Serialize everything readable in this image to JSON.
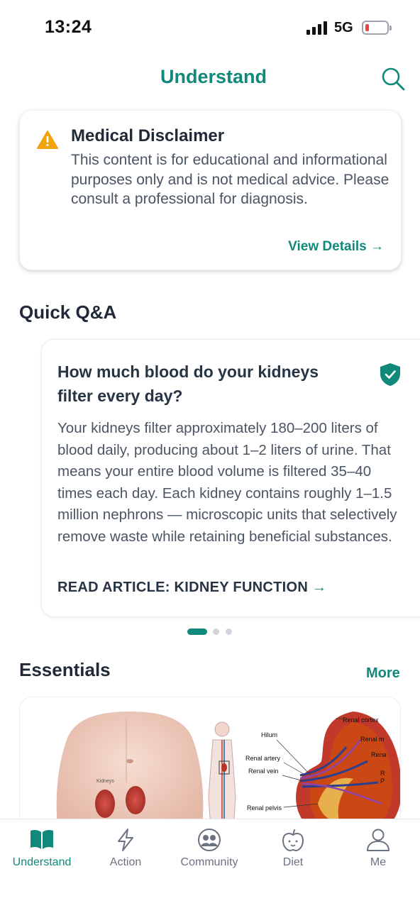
{
  "status_bar": {
    "time": "13:24",
    "network": "5G"
  },
  "header": {
    "title": "Understand"
  },
  "disclaimer": {
    "title": "Medical Disclaimer",
    "text": "This content is for educational and informational purposes only and is not medical advice. Please consult a professional for diagnosis.",
    "link_label": "View Details →"
  },
  "quick_qa": {
    "title": "Quick Q&A",
    "question": "How much blood do your kidneys filter every day?",
    "answer": "Your kidneys filter approximately 180–200 liters of blood daily, producing about 1–2 liters of urine. That means your entire blood volume is filtered 35–40 times each day. Each kidney contains roughly 1–1.5 million nephrons — microscopic units that selectively remove waste while retaining beneficial substances.",
    "read_label": "READ ARTICLE: KIDNEY FUNCTION",
    "read_arrow": "→",
    "page_count": 3,
    "active_page": 1
  },
  "essentials": {
    "title": "Essentials",
    "more_label": "More",
    "diagram_labels": {
      "small": "Kidneys",
      "hilum": "Hilum",
      "renal_artery": "Renal artery",
      "renal_vein": "Renal vein",
      "renal_pelvis": "Renal pelvis",
      "renal_cortex": "Renal cortex",
      "renal_m": "Renal m",
      "rena": "Rena",
      "r": "R",
      "p": "P"
    }
  },
  "tabs": [
    {
      "label": "Understand",
      "icon": "book-icon",
      "active": true
    },
    {
      "label": "Action",
      "icon": "lightning-icon",
      "active": false
    },
    {
      "label": "Community",
      "icon": "community-icon",
      "active": false
    },
    {
      "label": "Diet",
      "icon": "apple-icon",
      "active": false
    },
    {
      "label": "Me",
      "icon": "person-icon",
      "active": false
    }
  ],
  "colors": {
    "accent": "#11897a",
    "warning": "#f0a30a",
    "battery_low": "#ef4444"
  }
}
